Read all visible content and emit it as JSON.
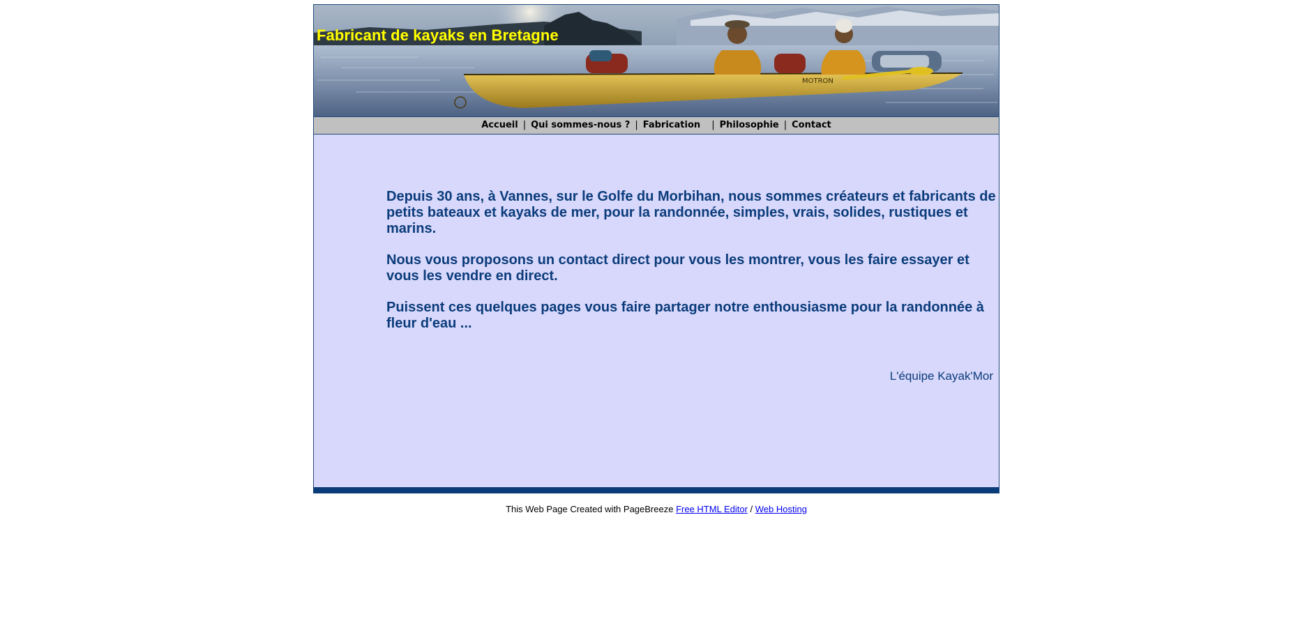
{
  "header": {
    "title": "Fabricant de kayaks en Bretagne"
  },
  "nav": {
    "items": [
      {
        "label": "Accueil"
      },
      {
        "label": "Qui sommes-nous ?"
      },
      {
        "label": "Fabrication"
      },
      {
        "label": "Philosophie"
      },
      {
        "label": "Contact"
      }
    ],
    "separator": "|"
  },
  "main": {
    "paragraphs": [
      "Depuis 30 ans, à  Vannes, sur le Golfe du Morbihan, nous sommes créateurs et fabricants de petits bateaux et kayaks de mer, pour la randonnée, simples, vrais, solides, rustiques et marins.",
      "Nous vous proposons un contact direct pour vous les montrer, vous les faire essayer et vous les vendre en direct.",
      "Puissent ces quelques pages vous faire partager notre enthousiasme pour la randonnée à fleur d'eau ..."
    ],
    "signature": "L'équipe Kayak'Mor"
  },
  "footer": {
    "prefix": "This Web Page Created with PageBreeze ",
    "link1": "Free HTML Editor",
    "divider": " / ",
    "link2": "Web Hosting"
  },
  "colors": {
    "title_yellow": "#ffff00",
    "text_blue": "#0b3c7a",
    "content_bg": "#d8d8fc",
    "nav_bg": "#c0c0c0"
  }
}
